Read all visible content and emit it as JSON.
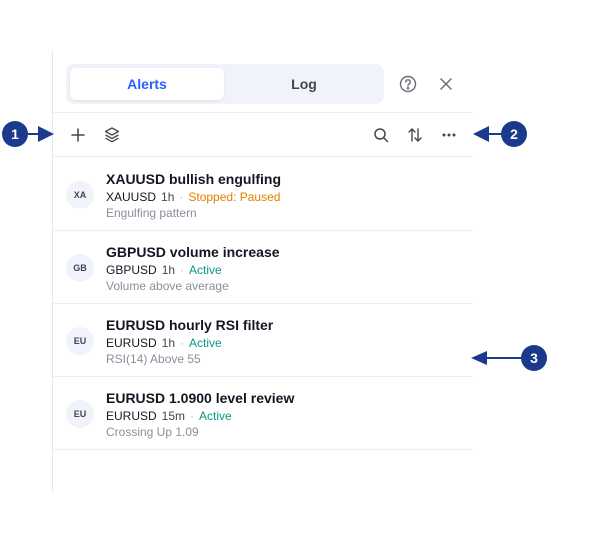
{
  "tabs": {
    "alerts": "Alerts",
    "log": "Log"
  },
  "header_icons": [
    "help-icon",
    "close-icon"
  ],
  "toolbar_icons": [
    "plus-icon",
    "layers-icon",
    "search-icon",
    "sort-icon",
    "more-icon"
  ],
  "alerts": [
    {
      "avatar": "XA",
      "title": "XAUUSD bullish engulfing",
      "symbol": "XAUUSD",
      "timeframe": "1h",
      "status": "Stopped: Paused",
      "description": "Engulfing pattern"
    },
    {
      "avatar": "GB",
      "title": "GBPUSD volume increase",
      "symbol": "GBPUSD",
      "timeframe": "1h",
      "status": "Active",
      "description": "Volume above average"
    },
    {
      "avatar": "EU",
      "title": "EURUSD hourly RSI filter",
      "symbol": "EURUSD",
      "timeframe": "1h",
      "status": "Active",
      "description": "RSI(14) Above 55"
    },
    {
      "avatar": "EU",
      "title": "EURUSD 1.0900 level review",
      "symbol": "EURUSD",
      "timeframe": "15m",
      "status": "Active",
      "description": "Crossing Up 1.09"
    }
  ],
  "callouts": [
    "1",
    "2",
    "3"
  ],
  "colors": {
    "accent": "#2962ff",
    "paused": "#e67e00",
    "active": "#089981",
    "callout": "#1b3a8c"
  }
}
